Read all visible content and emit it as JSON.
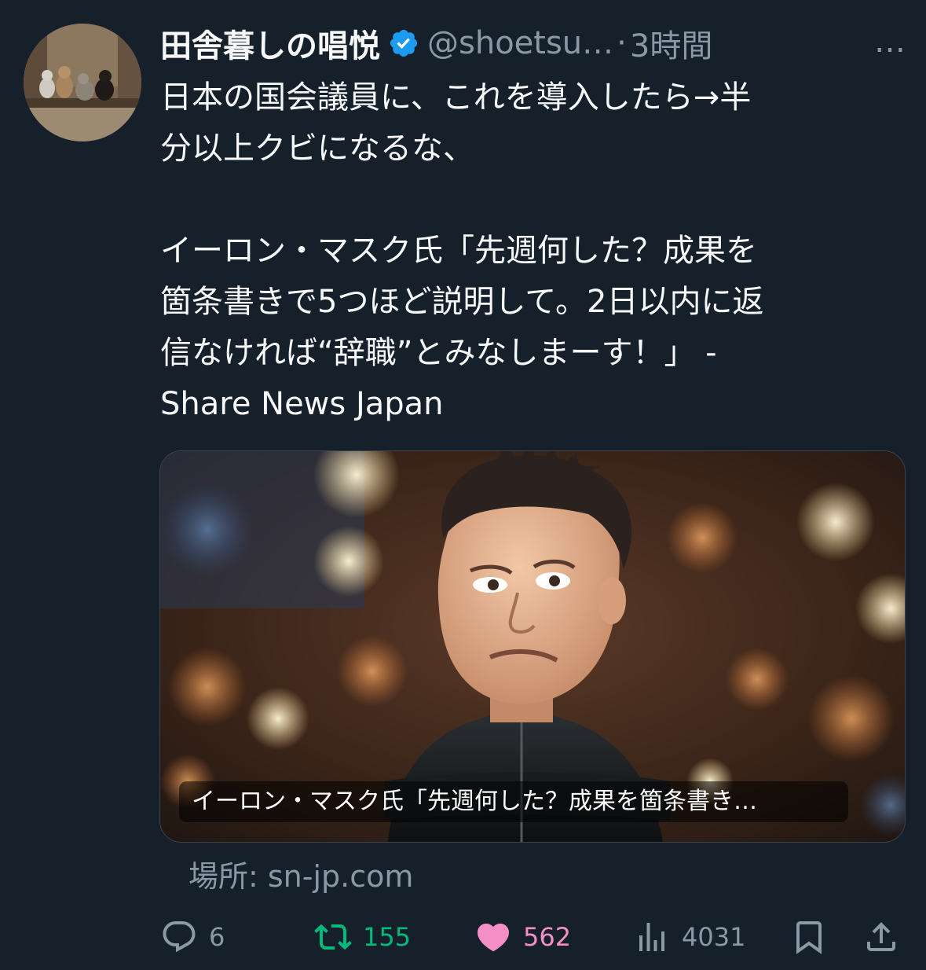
{
  "author": {
    "display_name": "田舎暮しの唱悦",
    "handle": "@shoetsu…",
    "separator": "·",
    "time": "3時間",
    "more_label": "…"
  },
  "tweet": {
    "text": "日本の国会議員に、これを導入したら→半\n分以上クビになるな、\n\nイーロン・マスク氏「先週何した？成果を\n箇条書きで5つほど説明して。2日以内に返\n信なければ“辞職”とみなしまーす！」 -\nShare News Japan"
  },
  "card": {
    "caption": "イーロン・マスク氏「先週何した？成果を箇条書き…",
    "source_label": "場所: sn-jp.com"
  },
  "actions": {
    "replies": "6",
    "retweets": "155",
    "likes": "562",
    "views": "4031"
  },
  "colors": {
    "background": "#15202b",
    "text": "#f7f9f9",
    "secondary": "#8b98a5",
    "verified": "#1d9bf0",
    "retweet": "#00ba7c",
    "like": "#f91880"
  },
  "icons": [
    "cats-avatar",
    "verified-badge-icon",
    "more-icon",
    "reply-icon",
    "retweet-icon",
    "like-icon",
    "views-icon",
    "bookmark-icon",
    "share-icon"
  ]
}
